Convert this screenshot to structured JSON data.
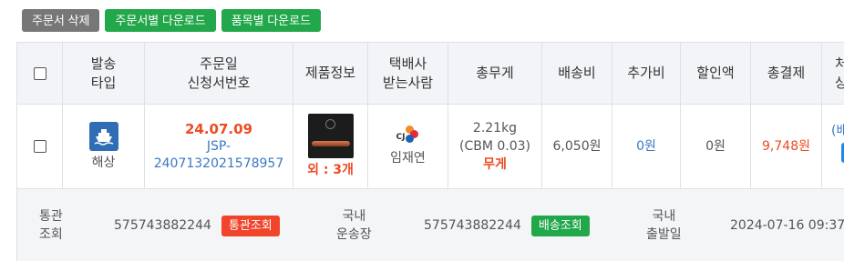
{
  "toolbar": {
    "delete_label": "주문서 삭제",
    "download_order_label": "주문서별 다운로드",
    "download_item_label": "품목별 다운로드"
  },
  "header": {
    "ship_type_1": "발송",
    "ship_type_2": "타입",
    "order_date_1": "주문일",
    "order_date_2": "신청서번호",
    "product": "제품정보",
    "courier_1": "택배사",
    "courier_2": "받는사람",
    "weight": "총무게",
    "shipping_fee": "배송비",
    "extra_fee": "추가비",
    "discount": "할인액",
    "total": "총결제",
    "status_1": "처",
    "status_2": "상"
  },
  "row": {
    "ship_type": "해상",
    "order_date": "24.07.09",
    "order_no_1": "JSP-",
    "order_no_2": "2407132021578957",
    "product_extra": "외 : 3개",
    "receiver": "임재연",
    "weight": "2.21kg",
    "cbm": "(CBM 0.03)",
    "weight_tag": "무게",
    "shipping_fee": "6,050원",
    "extra_fee": "0원",
    "discount": "0원",
    "total": "9,748원",
    "status": "(배"
  },
  "footer": {
    "customs_label_1": "통관",
    "customs_label_2": "조회",
    "customs_no": "575743882244",
    "customs_btn": "통관조회",
    "domestic_label_1": "국내",
    "domestic_label_2": "운송장",
    "domestic_no": "575743882244",
    "delivery_btn": "배송조회",
    "departure_label_1": "국내",
    "departure_label_2": "출발일",
    "departure_date": "2024-07-16 09:37"
  },
  "colors": {
    "accent_red": "#ef4a23",
    "link_blue": "#3b77c4",
    "button_green": "#22a74b",
    "button_gray": "#777777"
  },
  "icons": [
    "ship-icon",
    "cj-logo-icon",
    "product-thumbnail"
  ]
}
